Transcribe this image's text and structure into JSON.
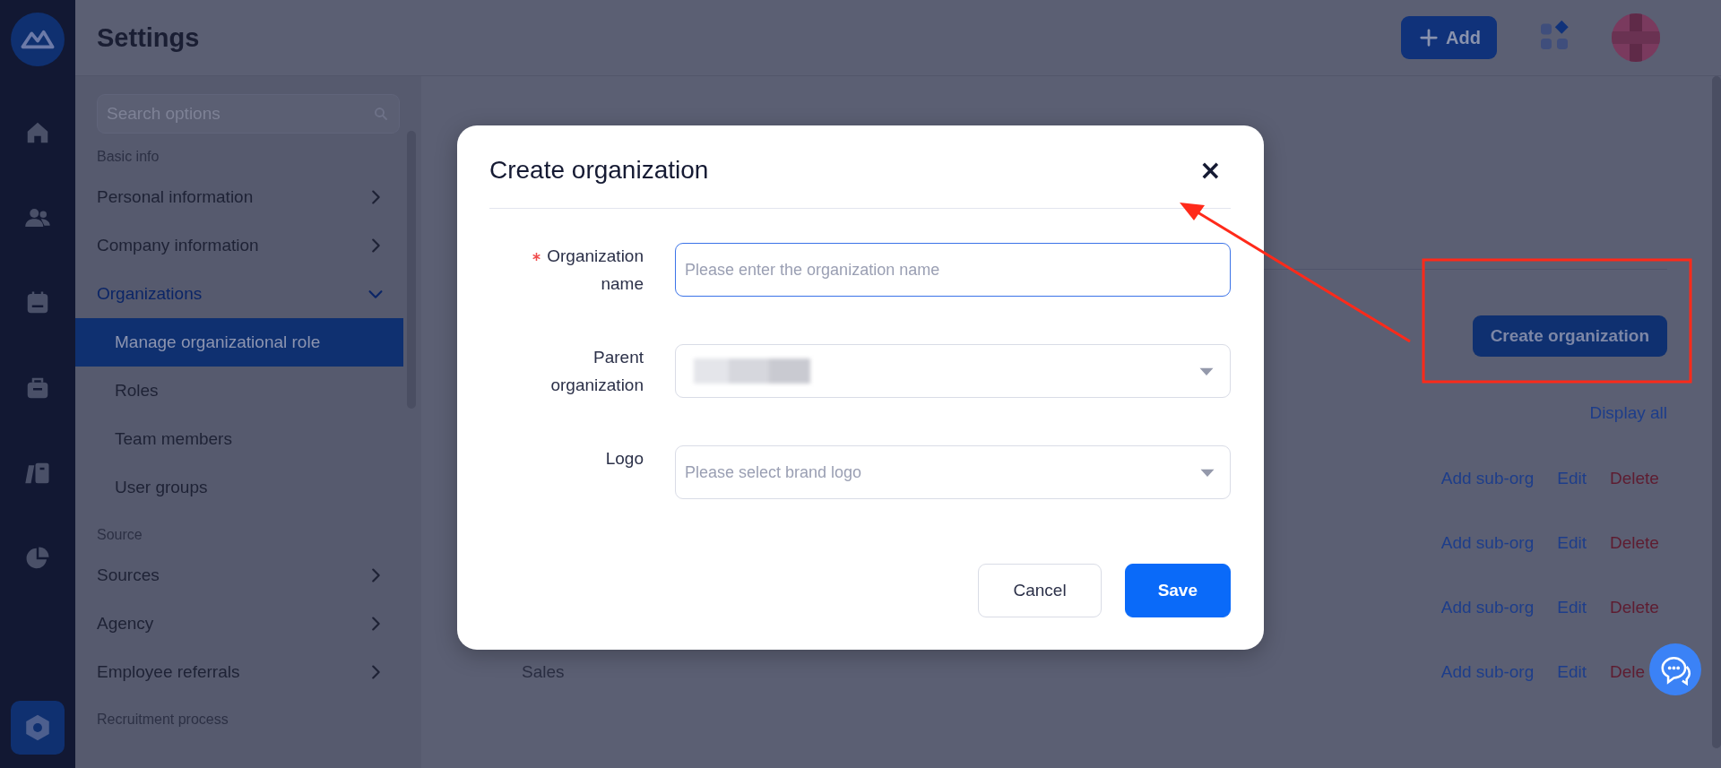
{
  "header": {
    "title": "Settings",
    "add_button": "Add"
  },
  "sidebar": {
    "search": {
      "placeholder": "Search options"
    },
    "sections": [
      {
        "heading": "Basic info",
        "items": [
          {
            "label": "Personal information",
            "expanded": false,
            "selected": false
          },
          {
            "label": "Company information",
            "expanded": false,
            "selected": false
          },
          {
            "label": "Organizations",
            "expanded": true,
            "selected": false,
            "children": [
              {
                "label": "Manage organizational role",
                "selected": true
              },
              {
                "label": "Roles",
                "selected": false
              },
              {
                "label": "Team members",
                "selected": false
              },
              {
                "label": "User groups",
                "selected": false
              }
            ]
          }
        ]
      },
      {
        "heading": "Source",
        "items": [
          {
            "label": "Sources",
            "expanded": false,
            "selected": false
          },
          {
            "label": "Agency",
            "expanded": false,
            "selected": false
          },
          {
            "label": "Employee referrals",
            "expanded": false,
            "selected": false
          }
        ]
      },
      {
        "heading": "Recruitment process"
      }
    ]
  },
  "main": {
    "create_button": "Create organization",
    "display_all": "Display all",
    "rows": [
      {
        "actions": [
          {
            "label": "Add sub-org",
            "kind": "link"
          },
          {
            "label": "Edit",
            "kind": "link"
          },
          {
            "label": "Delete",
            "kind": "danger"
          }
        ]
      },
      {
        "actions": [
          {
            "label": "Add sub-org",
            "kind": "link"
          },
          {
            "label": "Edit",
            "kind": "link"
          },
          {
            "label": "Delete",
            "kind": "danger"
          }
        ]
      },
      {
        "actions": [
          {
            "label": "Add sub-org",
            "kind": "link"
          },
          {
            "label": "Edit",
            "kind": "link"
          },
          {
            "label": "Delete",
            "kind": "danger"
          }
        ]
      },
      {
        "name": "Sales",
        "actions": [
          {
            "label": "Add sub-org",
            "kind": "link"
          },
          {
            "label": "Edit",
            "kind": "link"
          },
          {
            "label": "Dele",
            "kind": "danger"
          }
        ]
      }
    ]
  },
  "modal": {
    "title": "Create organization",
    "close": "×",
    "fields": [
      {
        "label": "Organization name",
        "required": true,
        "kind": "text",
        "placeholder": "Please enter the organization name",
        "focused": true
      },
      {
        "label": "Parent organization",
        "required": false,
        "kind": "select",
        "focused": false
      },
      {
        "label": "Logo",
        "required": false,
        "kind": "select",
        "placeholder": "Please select brand logo",
        "focused": false
      }
    ],
    "buttons": [
      {
        "label": "Cancel",
        "kind": "secondary"
      },
      {
        "label": "Save",
        "kind": "primary"
      }
    ]
  }
}
